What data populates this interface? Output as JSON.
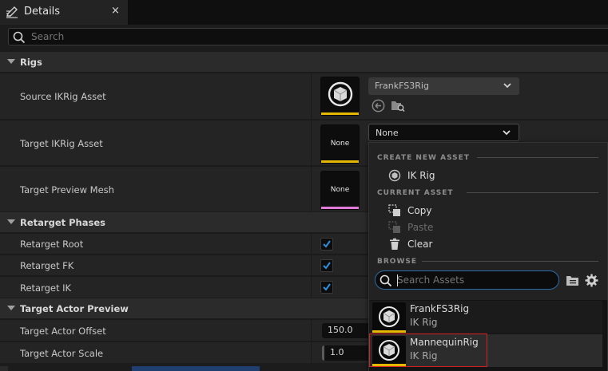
{
  "tab": {
    "title": "Details",
    "close": "×"
  },
  "search": {
    "placeholder": "Search"
  },
  "categories": {
    "rigs": "Rigs",
    "retarget_phases": "Retarget Phases",
    "target_actor_preview": "Target Actor Preview"
  },
  "rows": {
    "source_ikrig": {
      "label": "Source IKRig Asset",
      "value": "FrankFS3Rig"
    },
    "target_ikrig": {
      "label": "Target IKRig Asset",
      "value": "None",
      "thumb": "None"
    },
    "target_preview_mesh": {
      "label": "Target Preview Mesh",
      "thumb": "None"
    },
    "retarget_root": {
      "label": "Retarget Root"
    },
    "retarget_fk": {
      "label": "Retarget FK"
    },
    "retarget_ik": {
      "label": "Retarget IK"
    },
    "target_actor_offset": {
      "label": "Target Actor Offset",
      "value": "150.0"
    },
    "target_actor_scale": {
      "label": "Target Actor Scale",
      "value": "1.0"
    }
  },
  "popup": {
    "create_new_asset": "CREATE NEW ASSET",
    "ik_rig": "IK Rig",
    "current_asset": "CURRENT ASSET",
    "copy": "Copy",
    "paste": "Paste",
    "clear": "Clear",
    "browse": "BROWSE",
    "search_placeholder": "Search Assets",
    "assets": [
      {
        "name": "FrankFS3Rig",
        "type": "IK Rig"
      },
      {
        "name": "MannequinRig",
        "type": "IK Rig"
      }
    ]
  },
  "colors": {
    "accent_blue": "#2b6ca8",
    "ikrig_bar": "#e6b800",
    "mesh_bar": "#e07ad8",
    "selection_outline": "#d32020"
  }
}
